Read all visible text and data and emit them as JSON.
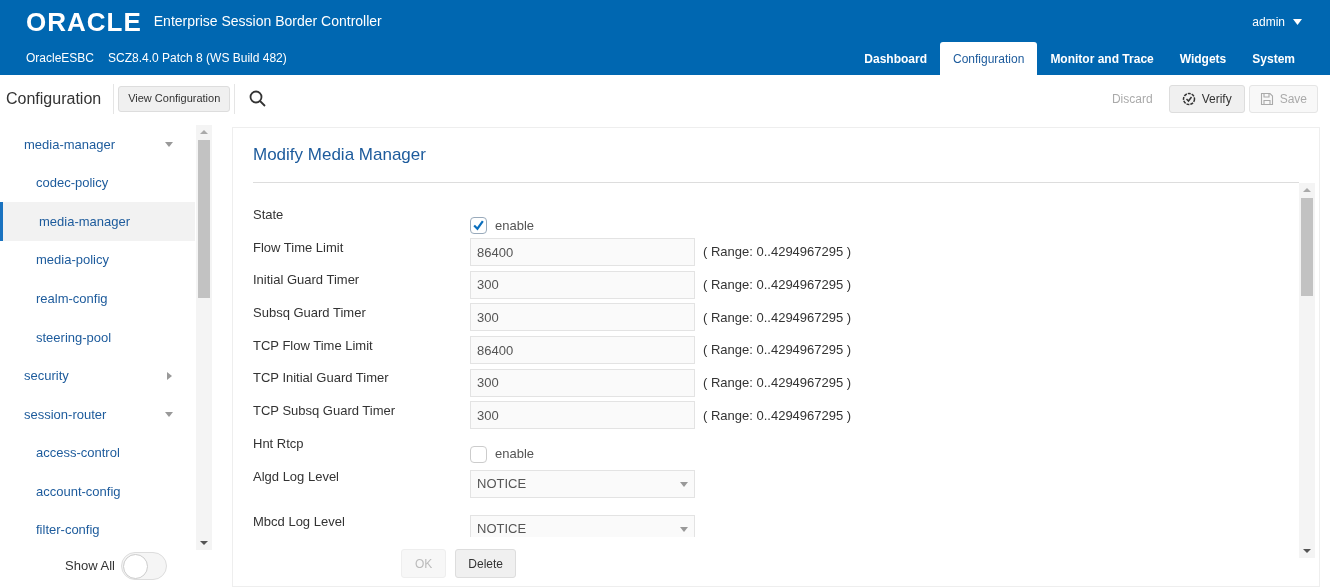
{
  "header": {
    "logo": "ORACLE",
    "product": "Enterprise Session Border Controller",
    "device": "OracleESBC",
    "version": "SCZ8.4.0 Patch 8 (WS Build 482)",
    "user": "admin",
    "tabs": [
      {
        "label": "Dashboard",
        "selected": false
      },
      {
        "label": "Configuration",
        "selected": true
      },
      {
        "label": "Monitor and Trace",
        "selected": false
      },
      {
        "label": "Widgets",
        "selected": false
      },
      {
        "label": "System",
        "selected": false
      }
    ]
  },
  "toolbar": {
    "title": "Configuration",
    "view_button": "View Configuration",
    "discard": "Discard",
    "verify": "Verify",
    "save": "Save",
    "save_disabled": true
  },
  "sidebar": {
    "groups": [
      {
        "label": "media-manager",
        "expanded": true,
        "children": [
          {
            "label": "codec-policy",
            "selected": false
          },
          {
            "label": "media-manager",
            "selected": true
          },
          {
            "label": "media-policy",
            "selected": false
          },
          {
            "label": "realm-config",
            "selected": false
          },
          {
            "label": "steering-pool",
            "selected": false
          }
        ]
      },
      {
        "label": "security",
        "expanded": false
      },
      {
        "label": "session-router",
        "expanded": true,
        "children": [
          {
            "label": "access-control",
            "selected": false
          },
          {
            "label": "account-config",
            "selected": false
          },
          {
            "label": "filter-config",
            "selected": false
          }
        ]
      }
    ],
    "show_all": {
      "label": "Show All",
      "on": false
    }
  },
  "form": {
    "title": "Modify Media Manager",
    "fields": [
      {
        "kind": "checkbox",
        "label": "State",
        "text": "enable",
        "checked": true
      },
      {
        "kind": "text",
        "label": "Flow Time Limit",
        "value": "86400",
        "hint": "( Range: 0..4294967295 )"
      },
      {
        "kind": "text",
        "label": "Initial Guard Timer",
        "value": "300",
        "hint": "( Range: 0..4294967295 )"
      },
      {
        "kind": "text",
        "label": "Subsq Guard Timer",
        "value": "300",
        "hint": "( Range: 0..4294967295 )"
      },
      {
        "kind": "text",
        "label": "TCP Flow Time Limit",
        "value": "86400",
        "hint": "( Range: 0..4294967295 )"
      },
      {
        "kind": "text",
        "label": "TCP Initial Guard Timer",
        "value": "300",
        "hint": "( Range: 0..4294967295 )"
      },
      {
        "kind": "text",
        "label": "TCP Subsq Guard Timer",
        "value": "300",
        "hint": "( Range: 0..4294967295 )"
      },
      {
        "kind": "checkbox",
        "label": "Hnt Rtcp",
        "text": "enable",
        "checked": false
      },
      {
        "kind": "select",
        "label": "Algd Log Level",
        "value": "NOTICE"
      },
      {
        "kind": "select",
        "label": "Mbcd Log Level",
        "value": "NOTICE"
      }
    ],
    "ok": "OK",
    "ok_disabled": true,
    "delete": "Delete"
  }
}
